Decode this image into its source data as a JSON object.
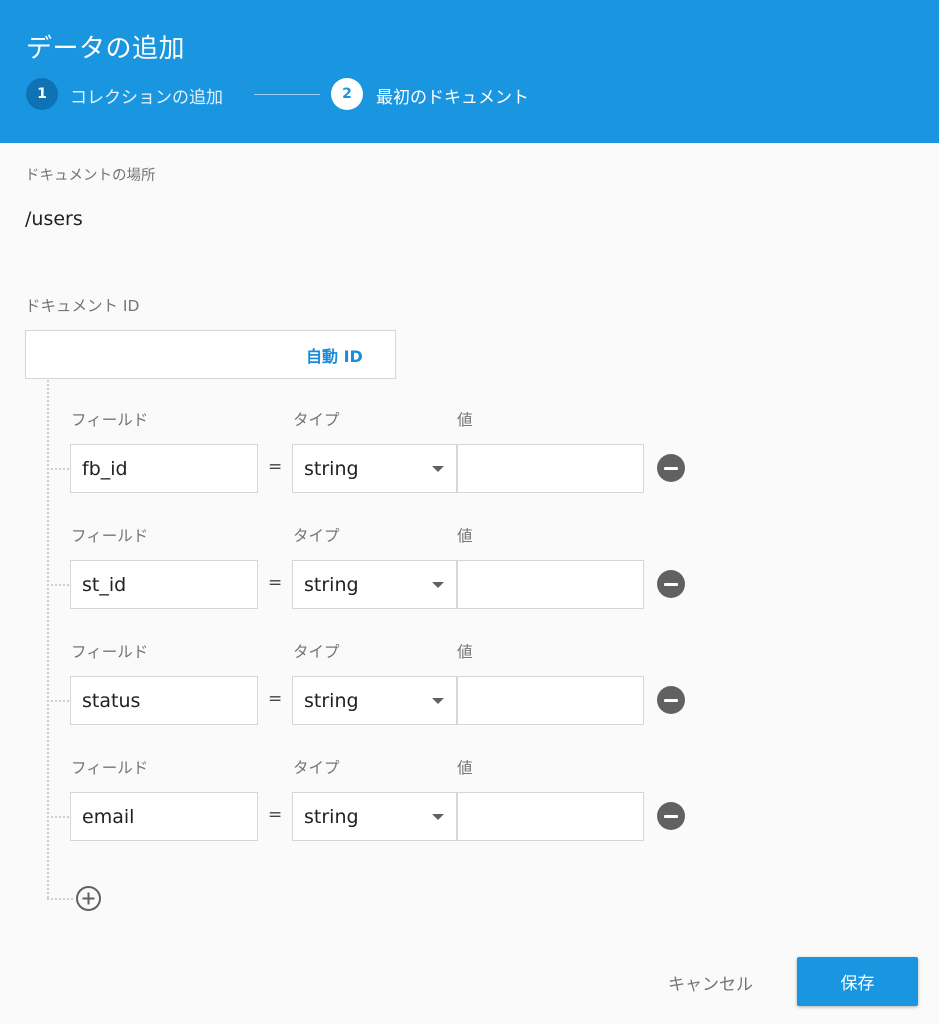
{
  "header": {
    "title": "データの追加",
    "steps": [
      {
        "number": "1",
        "label": "コレクションの追加"
      },
      {
        "number": "2",
        "label": "最初のドキュメント"
      }
    ]
  },
  "location": {
    "label": "ドキュメントの場所",
    "path": "/users"
  },
  "doc_id": {
    "label": "ドキュメント ID",
    "value": "",
    "auto_id_label": "自動 ID"
  },
  "column_labels": {
    "field": "フィールド",
    "type": "タイプ",
    "value": "値"
  },
  "fields": [
    {
      "name": "fb_id",
      "type": "string",
      "value": ""
    },
    {
      "name": "st_id",
      "type": "string",
      "value": ""
    },
    {
      "name": "status",
      "type": "string",
      "value": ""
    },
    {
      "name": "email",
      "type": "string",
      "value": ""
    }
  ],
  "equals_sign": "=",
  "actions": {
    "cancel_label": "キャンセル",
    "save_label": "保存"
  },
  "colors": {
    "primary": "#1a96e1",
    "step_active_circle": "#0f72b4",
    "remove_icon": "#616161"
  }
}
